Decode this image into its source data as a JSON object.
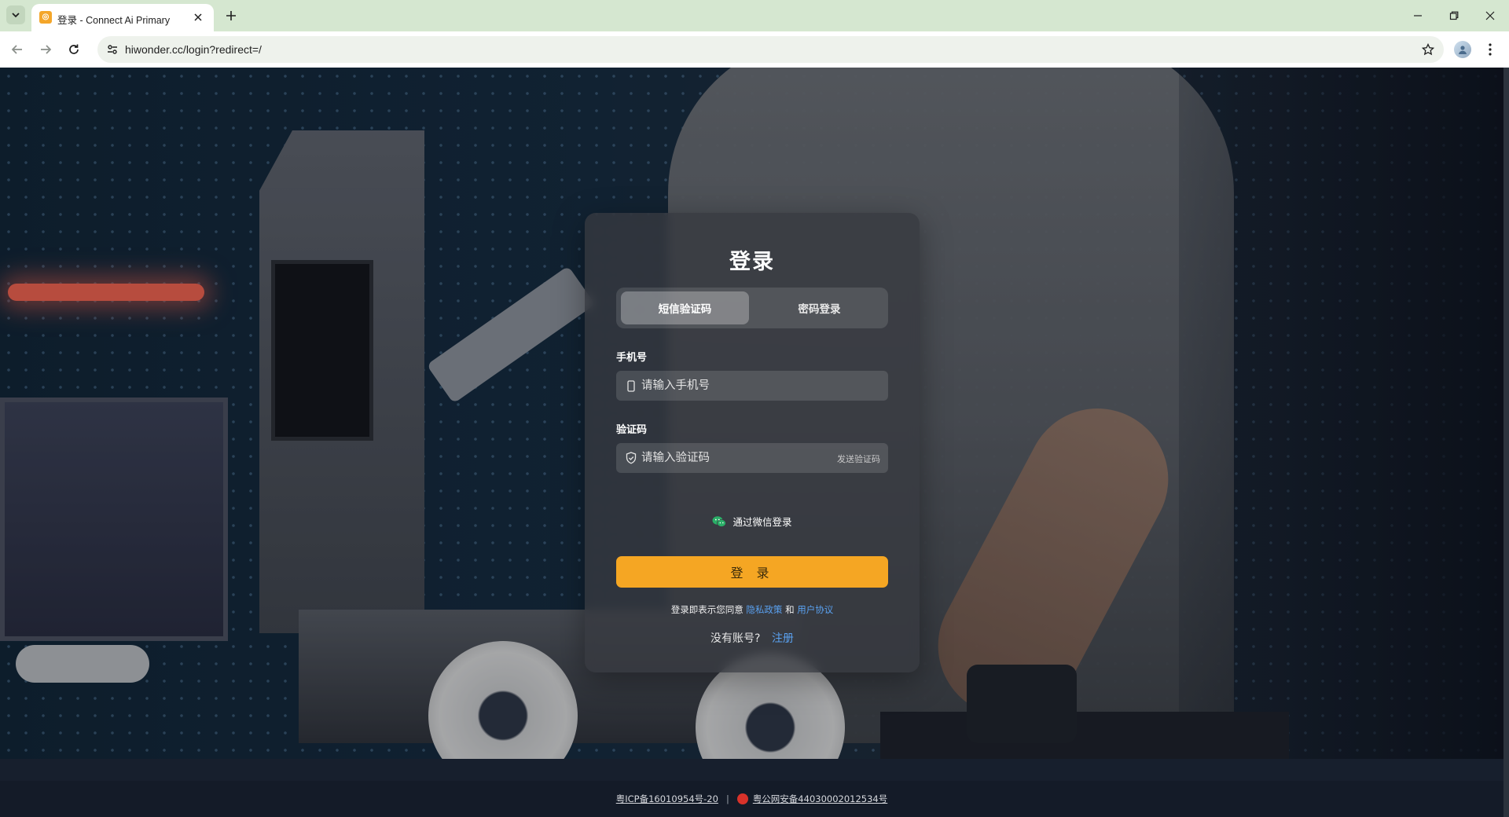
{
  "browser": {
    "tab_title": "登录 - Connect Ai Primary",
    "url": "hiwonder.cc/login?redirect=/"
  },
  "login": {
    "title": "登录",
    "tabs": [
      {
        "label": "短信验证码",
        "active": true
      },
      {
        "label": "密码登录",
        "active": false
      }
    ],
    "phone_label": "手机号",
    "phone_placeholder": "请输入手机号",
    "code_label": "验证码",
    "code_placeholder": "请输入验证码",
    "send_code": "发送验证码",
    "wechat_login": "通过微信登录",
    "submit": "登 录",
    "agree_prefix": "登录即表示您同意",
    "privacy_policy": "隐私政策",
    "agree_and": "和",
    "user_agreement": "用户协议",
    "no_account": "没有账号?",
    "register": "注册"
  },
  "footer": {
    "icp": "粤ICP备16010954号-20",
    "separator": "|",
    "police": "粤公网安备44030002012534号"
  },
  "colors": {
    "accent": "#f5a623",
    "link": "#5aa1f0",
    "wechat": "#2aae67"
  },
  "icons": [
    "chevron-down-icon",
    "close-icon",
    "plus-icon",
    "minimize-icon",
    "restore-icon",
    "back-arrow-icon",
    "forward-arrow-icon",
    "reload-icon",
    "site-info-icon",
    "star-icon",
    "profile-avatar",
    "kebab-menu-icon",
    "phone-icon",
    "shield-icon",
    "wechat-icon",
    "police-badge-icon"
  ]
}
